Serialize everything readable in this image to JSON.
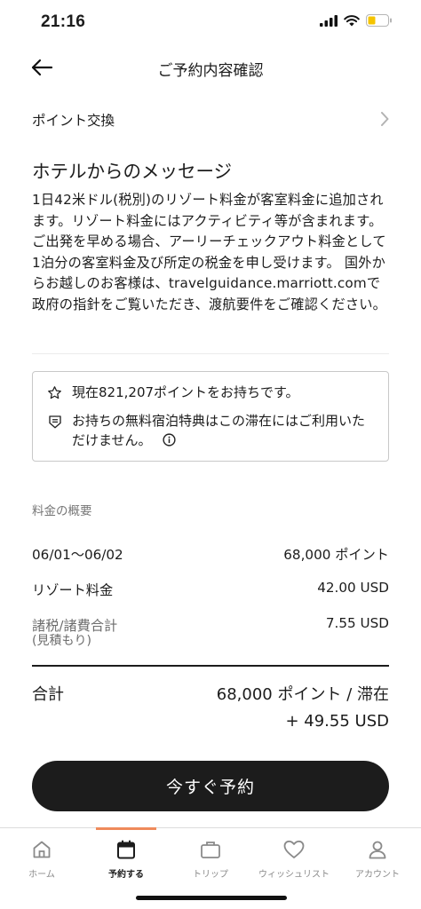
{
  "status_bar": {
    "time": "21:16"
  },
  "header": {
    "title": "ご予約内容確認"
  },
  "options": {
    "points_exchange_label": "ポイント交換"
  },
  "message": {
    "title": "ホテルからのメッセージ",
    "body": "1日42米ドル(税別)のリゾート料金が客室料金に追加されます。リゾート料金にはアクティビティ等が含まれます。ご出発を早める場合、アーリーチェックアウト料金として1泊分の客室料金及び所定の税金を申し受けます。 国外からお越しのお客様は、travelguidance.marriott.comで政府の指針をご覧いただき、渡航要件をご確認ください。"
  },
  "info_box": {
    "points_balance": "現在821,207ポイントをお持ちです。",
    "free_night_notice": "お持ちの無料宿泊特典はこの滞在にはご利用いただけません。"
  },
  "summary": {
    "heading": "料金の概要",
    "rows": [
      {
        "label": "06/01〜06/02",
        "value": "68,000 ポイント"
      },
      {
        "label": "リゾート料金",
        "value": "42.00 USD"
      },
      {
        "label": "諸税/諸費合計",
        "sublabel": "(見積もり)",
        "value": "7.55 USD"
      }
    ],
    "total_label": "合計",
    "total_points": "68,000 ポイント / 滞在",
    "total_usd": "+ 49.55 USD"
  },
  "book_button": {
    "label": "今すぐ予約"
  },
  "tabs": [
    {
      "label": "ホーム",
      "icon": "home-icon",
      "active": false
    },
    {
      "label": "予約する",
      "icon": "calendar-icon",
      "active": true
    },
    {
      "label": "トリップ",
      "icon": "briefcase-icon",
      "active": false
    },
    {
      "label": "ウィッシュリスト",
      "icon": "heart-icon",
      "active": false
    },
    {
      "label": "アカウント",
      "icon": "person-icon",
      "active": false
    }
  ],
  "colors": {
    "accent": "#ef8a5b",
    "button": "#1c1c1c",
    "battery": "#f5c400"
  }
}
